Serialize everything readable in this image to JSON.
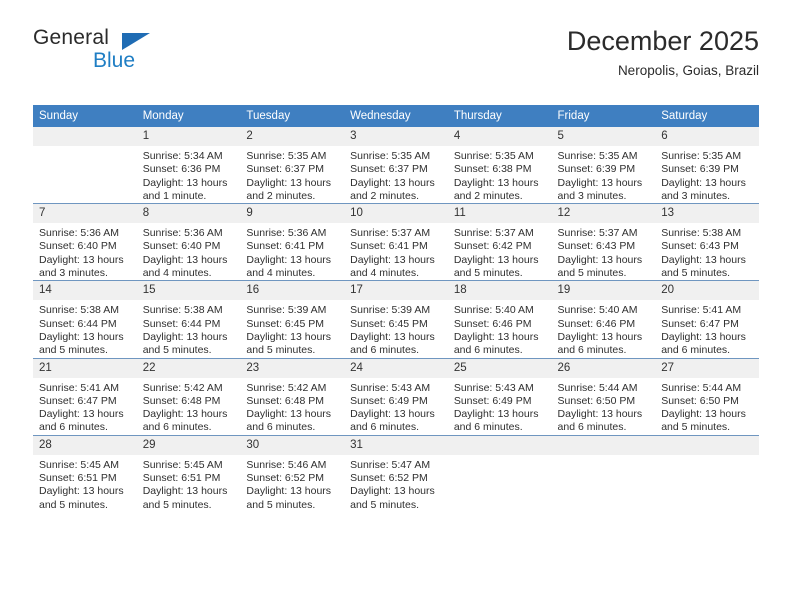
{
  "brand": {
    "name_part1": "General",
    "name_part2": "Blue",
    "triangle_color": "#1f6cb4",
    "blue_color": "#1f7ec4"
  },
  "header": {
    "title": "December 2025",
    "subtitle": "Neropolis, Goias, Brazil",
    "header_bg_color": "#3f7fc1",
    "daynum_bg_color": "#f0f0f0",
    "row_divider_color": "#6f96c0"
  },
  "weekday_headers": [
    "Sunday",
    "Monday",
    "Tuesday",
    "Wednesday",
    "Thursday",
    "Friday",
    "Saturday"
  ],
  "weeks": [
    [
      {
        "day": "",
        "sunrise": "",
        "sunset": "",
        "daylight_line1": "",
        "daylight_line2": ""
      },
      {
        "day": "1",
        "sunrise": "Sunrise: 5:34 AM",
        "sunset": "Sunset: 6:36 PM",
        "daylight_line1": "Daylight: 13 hours",
        "daylight_line2": "and 1 minute."
      },
      {
        "day": "2",
        "sunrise": "Sunrise: 5:35 AM",
        "sunset": "Sunset: 6:37 PM",
        "daylight_line1": "Daylight: 13 hours",
        "daylight_line2": "and 2 minutes."
      },
      {
        "day": "3",
        "sunrise": "Sunrise: 5:35 AM",
        "sunset": "Sunset: 6:37 PM",
        "daylight_line1": "Daylight: 13 hours",
        "daylight_line2": "and 2 minutes."
      },
      {
        "day": "4",
        "sunrise": "Sunrise: 5:35 AM",
        "sunset": "Sunset: 6:38 PM",
        "daylight_line1": "Daylight: 13 hours",
        "daylight_line2": "and 2 minutes."
      },
      {
        "day": "5",
        "sunrise": "Sunrise: 5:35 AM",
        "sunset": "Sunset: 6:39 PM",
        "daylight_line1": "Daylight: 13 hours",
        "daylight_line2": "and 3 minutes."
      },
      {
        "day": "6",
        "sunrise": "Sunrise: 5:35 AM",
        "sunset": "Sunset: 6:39 PM",
        "daylight_line1": "Daylight: 13 hours",
        "daylight_line2": "and 3 minutes."
      }
    ],
    [
      {
        "day": "7",
        "sunrise": "Sunrise: 5:36 AM",
        "sunset": "Sunset: 6:40 PM",
        "daylight_line1": "Daylight: 13 hours",
        "daylight_line2": "and 3 minutes."
      },
      {
        "day": "8",
        "sunrise": "Sunrise: 5:36 AM",
        "sunset": "Sunset: 6:40 PM",
        "daylight_line1": "Daylight: 13 hours",
        "daylight_line2": "and 4 minutes."
      },
      {
        "day": "9",
        "sunrise": "Sunrise: 5:36 AM",
        "sunset": "Sunset: 6:41 PM",
        "daylight_line1": "Daylight: 13 hours",
        "daylight_line2": "and 4 minutes."
      },
      {
        "day": "10",
        "sunrise": "Sunrise: 5:37 AM",
        "sunset": "Sunset: 6:41 PM",
        "daylight_line1": "Daylight: 13 hours",
        "daylight_line2": "and 4 minutes."
      },
      {
        "day": "11",
        "sunrise": "Sunrise: 5:37 AM",
        "sunset": "Sunset: 6:42 PM",
        "daylight_line1": "Daylight: 13 hours",
        "daylight_line2": "and 5 minutes."
      },
      {
        "day": "12",
        "sunrise": "Sunrise: 5:37 AM",
        "sunset": "Sunset: 6:43 PM",
        "daylight_line1": "Daylight: 13 hours",
        "daylight_line2": "and 5 minutes."
      },
      {
        "day": "13",
        "sunrise": "Sunrise: 5:38 AM",
        "sunset": "Sunset: 6:43 PM",
        "daylight_line1": "Daylight: 13 hours",
        "daylight_line2": "and 5 minutes."
      }
    ],
    [
      {
        "day": "14",
        "sunrise": "Sunrise: 5:38 AM",
        "sunset": "Sunset: 6:44 PM",
        "daylight_line1": "Daylight: 13 hours",
        "daylight_line2": "and 5 minutes."
      },
      {
        "day": "15",
        "sunrise": "Sunrise: 5:38 AM",
        "sunset": "Sunset: 6:44 PM",
        "daylight_line1": "Daylight: 13 hours",
        "daylight_line2": "and 5 minutes."
      },
      {
        "day": "16",
        "sunrise": "Sunrise: 5:39 AM",
        "sunset": "Sunset: 6:45 PM",
        "daylight_line1": "Daylight: 13 hours",
        "daylight_line2": "and 5 minutes."
      },
      {
        "day": "17",
        "sunrise": "Sunrise: 5:39 AM",
        "sunset": "Sunset: 6:45 PM",
        "daylight_line1": "Daylight: 13 hours",
        "daylight_line2": "and 6 minutes."
      },
      {
        "day": "18",
        "sunrise": "Sunrise: 5:40 AM",
        "sunset": "Sunset: 6:46 PM",
        "daylight_line1": "Daylight: 13 hours",
        "daylight_line2": "and 6 minutes."
      },
      {
        "day": "19",
        "sunrise": "Sunrise: 5:40 AM",
        "sunset": "Sunset: 6:46 PM",
        "daylight_line1": "Daylight: 13 hours",
        "daylight_line2": "and 6 minutes."
      },
      {
        "day": "20",
        "sunrise": "Sunrise: 5:41 AM",
        "sunset": "Sunset: 6:47 PM",
        "daylight_line1": "Daylight: 13 hours",
        "daylight_line2": "and 6 minutes."
      }
    ],
    [
      {
        "day": "21",
        "sunrise": "Sunrise: 5:41 AM",
        "sunset": "Sunset: 6:47 PM",
        "daylight_line1": "Daylight: 13 hours",
        "daylight_line2": "and 6 minutes."
      },
      {
        "day": "22",
        "sunrise": "Sunrise: 5:42 AM",
        "sunset": "Sunset: 6:48 PM",
        "daylight_line1": "Daylight: 13 hours",
        "daylight_line2": "and 6 minutes."
      },
      {
        "day": "23",
        "sunrise": "Sunrise: 5:42 AM",
        "sunset": "Sunset: 6:48 PM",
        "daylight_line1": "Daylight: 13 hours",
        "daylight_line2": "and 6 minutes."
      },
      {
        "day": "24",
        "sunrise": "Sunrise: 5:43 AM",
        "sunset": "Sunset: 6:49 PM",
        "daylight_line1": "Daylight: 13 hours",
        "daylight_line2": "and 6 minutes."
      },
      {
        "day": "25",
        "sunrise": "Sunrise: 5:43 AM",
        "sunset": "Sunset: 6:49 PM",
        "daylight_line1": "Daylight: 13 hours",
        "daylight_line2": "and 6 minutes."
      },
      {
        "day": "26",
        "sunrise": "Sunrise: 5:44 AM",
        "sunset": "Sunset: 6:50 PM",
        "daylight_line1": "Daylight: 13 hours",
        "daylight_line2": "and 6 minutes."
      },
      {
        "day": "27",
        "sunrise": "Sunrise: 5:44 AM",
        "sunset": "Sunset: 6:50 PM",
        "daylight_line1": "Daylight: 13 hours",
        "daylight_line2": "and 5 minutes."
      }
    ],
    [
      {
        "day": "28",
        "sunrise": "Sunrise: 5:45 AM",
        "sunset": "Sunset: 6:51 PM",
        "daylight_line1": "Daylight: 13 hours",
        "daylight_line2": "and 5 minutes."
      },
      {
        "day": "29",
        "sunrise": "Sunrise: 5:45 AM",
        "sunset": "Sunset: 6:51 PM",
        "daylight_line1": "Daylight: 13 hours",
        "daylight_line2": "and 5 minutes."
      },
      {
        "day": "30",
        "sunrise": "Sunrise: 5:46 AM",
        "sunset": "Sunset: 6:52 PM",
        "daylight_line1": "Daylight: 13 hours",
        "daylight_line2": "and 5 minutes."
      },
      {
        "day": "31",
        "sunrise": "Sunrise: 5:47 AM",
        "sunset": "Sunset: 6:52 PM",
        "daylight_line1": "Daylight: 13 hours",
        "daylight_line2": "and 5 minutes."
      },
      {
        "day": "",
        "sunrise": "",
        "sunset": "",
        "daylight_line1": "",
        "daylight_line2": ""
      },
      {
        "day": "",
        "sunrise": "",
        "sunset": "",
        "daylight_line1": "",
        "daylight_line2": ""
      },
      {
        "day": "",
        "sunrise": "",
        "sunset": "",
        "daylight_line1": "",
        "daylight_line2": ""
      }
    ]
  ]
}
